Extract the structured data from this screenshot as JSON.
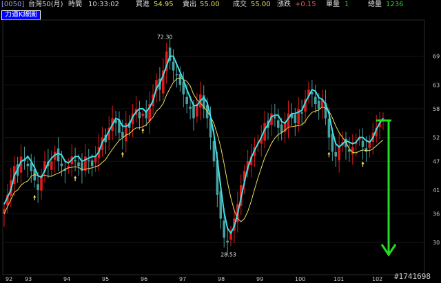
{
  "header": {
    "code": "[0050]",
    "name": "台灣50(月)",
    "time_label": "時間",
    "time_value": "10:33:02",
    "bid_label": "買進",
    "bid_value": "54.95",
    "ask_label": "賣出",
    "ask_value": "55.00",
    "deal_label": "成交",
    "deal_value": "55.00",
    "change_label": "漲跌",
    "change_value": "+0.15",
    "vol_label": "單量",
    "vol_value": "1",
    "total_label": "總量",
    "total_value": "1236"
  },
  "tab": {
    "label": "力道K線圖"
  },
  "colors": {
    "bg": "#000000",
    "up": "#e11a1a",
    "down": "#48a0a0",
    "ma_cyan": "#40e0e8",
    "ma_yellow": "#f0e060",
    "arrow": "#22dd22",
    "label_yellow": "#e8e060",
    "label_red": "#ff5050",
    "label_green": "#30d030"
  },
  "annotations": {
    "high": "72.30",
    "low": "28.53",
    "watermark": "#1741698"
  },
  "chart_data": {
    "type": "candlestick",
    "y_ticks": [
      "69",
      "63",
      "58",
      "52",
      "47",
      "41",
      "36",
      "30"
    ],
    "x_ticks": [
      "92",
      "93",
      "94",
      "95",
      "96",
      "97",
      "98",
      "99",
      "100",
      "101",
      "102"
    ],
    "ylim": [
      26,
      75
    ],
    "high_value": 72.3,
    "low_value": 28.53,
    "closes": [
      37,
      40,
      43,
      46,
      44,
      48,
      47,
      46,
      45,
      43,
      41,
      44,
      47,
      46,
      47,
      49,
      47,
      46,
      45,
      46,
      48,
      47,
      46,
      45,
      48,
      47,
      46,
      48,
      50,
      52,
      51,
      54,
      56,
      55,
      53,
      52,
      55,
      54,
      57,
      58,
      56,
      57,
      56,
      59,
      61,
      64,
      62,
      66,
      70,
      68,
      66,
      65,
      63,
      61,
      59,
      58,
      56,
      59,
      61,
      58,
      56,
      52,
      47,
      40,
      35,
      31,
      30,
      32,
      35,
      38,
      42,
      45,
      47,
      48,
      50,
      51,
      52,
      55,
      54,
      57,
      56,
      54,
      53,
      55,
      57,
      56,
      55,
      58,
      57,
      60,
      62,
      61,
      59,
      58,
      60,
      56,
      52,
      49,
      48,
      50,
      51,
      50,
      49,
      50,
      51,
      52,
      50,
      49,
      51,
      53,
      54,
      55,
      56
    ]
  }
}
